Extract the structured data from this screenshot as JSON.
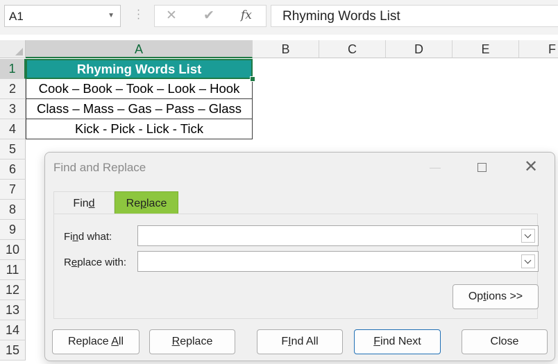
{
  "formula_bar": {
    "name_box": "A1",
    "formula_text": "Rhyming Words List",
    "icons": [
      "cancel-icon",
      "enter-check-icon",
      "insert-function-icon"
    ],
    "fx_label": "fx"
  },
  "grid": {
    "columns": [
      "A",
      "B",
      "C",
      "D",
      "E",
      "F"
    ],
    "rows": [
      "1",
      "2",
      "3",
      "4",
      "5",
      "6",
      "7",
      "8",
      "9",
      "10",
      "11",
      "12",
      "13",
      "14",
      "15"
    ],
    "selected_cell": "A1",
    "cells": {
      "a1": "Rhyming Words List",
      "a2": "Cook – Book – Took – Look – Hook",
      "a3": "Class – Mass – Gas – Pass – Glass",
      "a4": "Kick - Pick - Lick - Tick"
    },
    "header_fill_color": "#1a9c96",
    "selection_color": "#1f7a45"
  },
  "dialog": {
    "title": "Find and Replace",
    "tabs": {
      "find": {
        "pre": "Fin",
        "key": "d",
        "post": ""
      },
      "replace": {
        "pre": "Re",
        "key": "p",
        "post": "lace"
      }
    },
    "active_tab": "replace",
    "active_tab_color": "#8dc63f",
    "find_what": {
      "pre": "Fi",
      "key": "n",
      "post": "d what:",
      "value": ""
    },
    "replace_with": {
      "pre": "R",
      "key": "e",
      "post": "place with:",
      "value": ""
    },
    "options_button": {
      "pre": "Op",
      "key": "t",
      "post": "ions >>"
    },
    "buttons": {
      "replace_all": {
        "pre": "Replace ",
        "key": "A",
        "post": "ll"
      },
      "replace": {
        "pre": "",
        "key": "R",
        "post": "eplace"
      },
      "find_all": {
        "pre": "",
        "key": "I",
        "post": "nd All"
      },
      "find_next": {
        "pre": "",
        "key": "F",
        "post": "ind Next"
      },
      "close": "Close"
    }
  }
}
